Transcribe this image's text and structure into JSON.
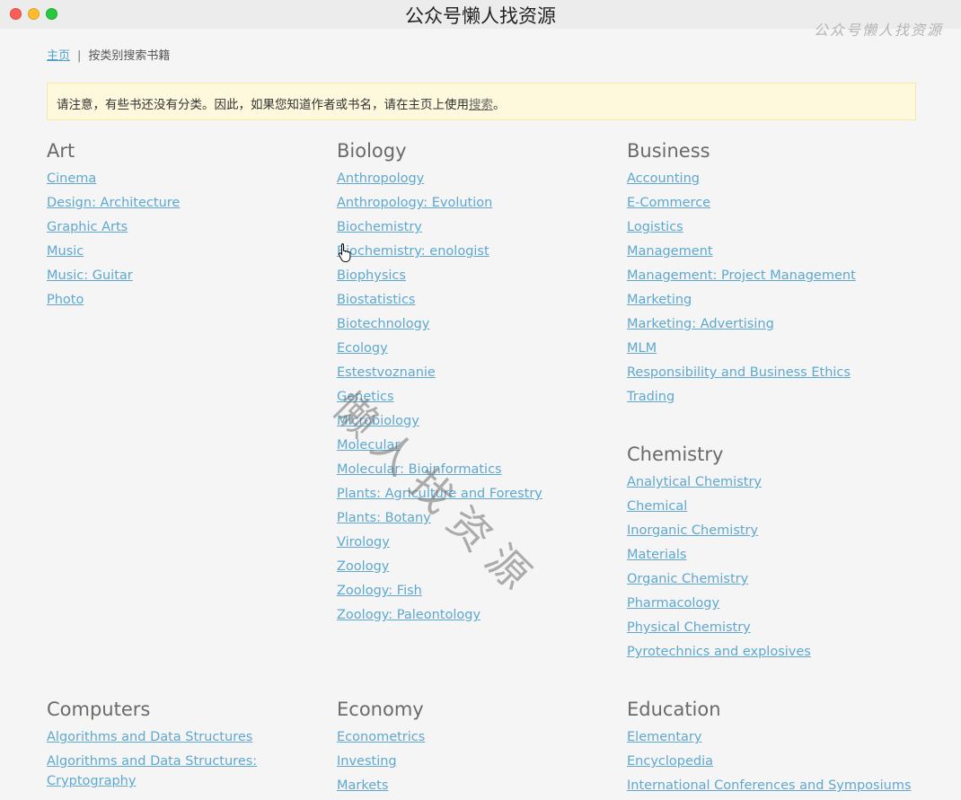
{
  "window": {
    "title": "公众号懒人找资源",
    "corner_watermark": "公众号懒人找资源"
  },
  "breadcrumb": {
    "home": "主页",
    "separator": "|",
    "current": "按类别搜索书籍"
  },
  "notice": {
    "text": "请注意，有些书还没有分类。因此，如果您知道作者或书名，请在主页上使用",
    "link": "搜索",
    "end": "。"
  },
  "watermark": "懒人找资源",
  "categories": [
    {
      "title": "Art",
      "items": [
        "Cinema",
        "Design: Architecture",
        "Graphic Arts",
        "Music",
        "Music: Guitar",
        "Photo"
      ]
    },
    {
      "title": "Biology",
      "items": [
        "Anthropology",
        "Anthropology: Evolution",
        "Biochemistry",
        "Biochemistry: enologist",
        "Biophysics",
        "Biostatistics",
        "Biotechnology",
        "Ecology",
        "Estestvoznanie",
        "Genetics",
        "Microbiology",
        "Molecular",
        "Molecular: Bioinformatics",
        "Plants: Agriculture and Forestry",
        "Plants: Botany",
        "Virology",
        "Zoology",
        "Zoology: Fish",
        "Zoology: Paleontology"
      ]
    },
    {
      "title": "Business",
      "items": [
        "Accounting",
        "E-Commerce",
        "Logistics",
        "Management",
        "Management: Project Management",
        "Marketing",
        "Marketing: Advertising",
        "MLM",
        "Responsibility and Business Ethics",
        "Trading"
      ]
    },
    {
      "title": "Chemistry",
      "items": [
        "Analytical Chemistry",
        "Chemical",
        "Inorganic Chemistry",
        "Materials",
        "Organic Chemistry",
        "Pharmacology",
        "Physical Chemistry",
        "Pyrotechnics and explosives"
      ]
    },
    {
      "title": "Computers",
      "items": [
        "Algorithms and Data Structures",
        "Algorithms and Data Structures: Cryptography"
      ]
    },
    {
      "title": "Economy",
      "items": [
        "Econometrics",
        "Investing",
        "Markets"
      ]
    },
    {
      "title": "Education",
      "items": [
        "Elementary",
        "Encyclopedia",
        "International Conferences and Symposiums"
      ]
    }
  ]
}
